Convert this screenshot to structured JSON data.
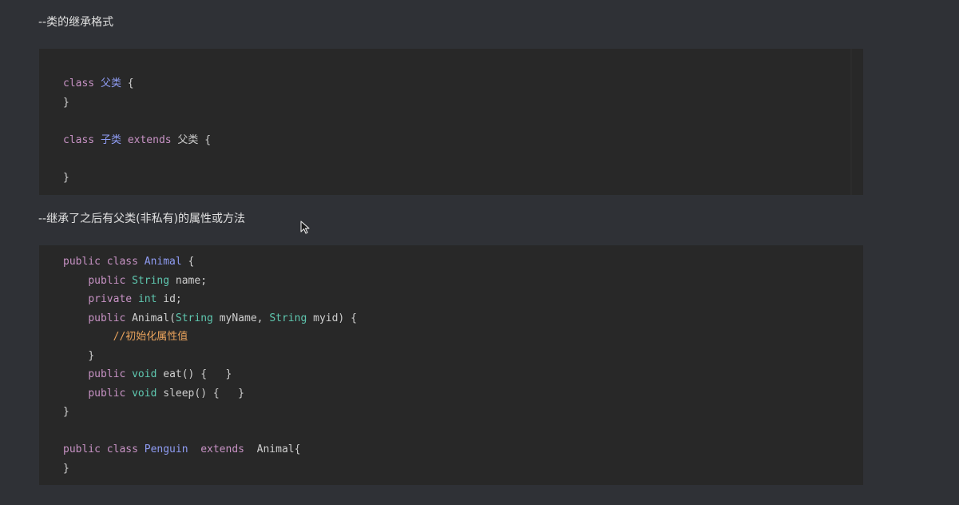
{
  "paragraphs": {
    "inherit_format": "--类的继承格式",
    "inherit_after": "--继承了之后有父类(非私有)的属性或方法",
    "partial_next": "…"
  },
  "code_block_1": {
    "l1": {
      "kw": "class",
      "cls": "父类",
      "rest": " {"
    },
    "l2": "}",
    "l3": {
      "kw": "class",
      "cls": "子类",
      "kw2": "extends",
      "rest": " 父类 {"
    },
    "l4": "}"
  },
  "code_block_2": {
    "l1": {
      "kw": "public class",
      "cls": "Animal",
      "rest": " {"
    },
    "l2": {
      "kw": "public",
      "typ": "String",
      "rest": " name;"
    },
    "l3": {
      "kw": "private",
      "typ": "int",
      "rest": " id;"
    },
    "l4": {
      "kw": "public",
      "name": " Animal(",
      "typ1": "String",
      "p1": " myName, ",
      "typ2": "String",
      "p2": " myid) {"
    },
    "l5": {
      "cmt": "//初始化属性值"
    },
    "l6": "}",
    "l7": {
      "kw": "public",
      "typ": "void",
      "rest": " eat() {   }"
    },
    "l8": {
      "kw": "public",
      "typ": "void",
      "rest": " sleep() {   }"
    },
    "l9": "}",
    "l10": {
      "kw": "public class",
      "cls": "Penguin",
      "kw2": "extends",
      "rest": "  Animal{"
    },
    "l11": "}"
  },
  "colors": {
    "background": "#2f3136",
    "code_background": "#282828",
    "keyword": "#c792c4",
    "class_name": "#8f9cf3",
    "type": "#5fc8b0",
    "comment": "#e8a25c"
  },
  "icons": {
    "cursor": "mouse-pointer-icon"
  }
}
